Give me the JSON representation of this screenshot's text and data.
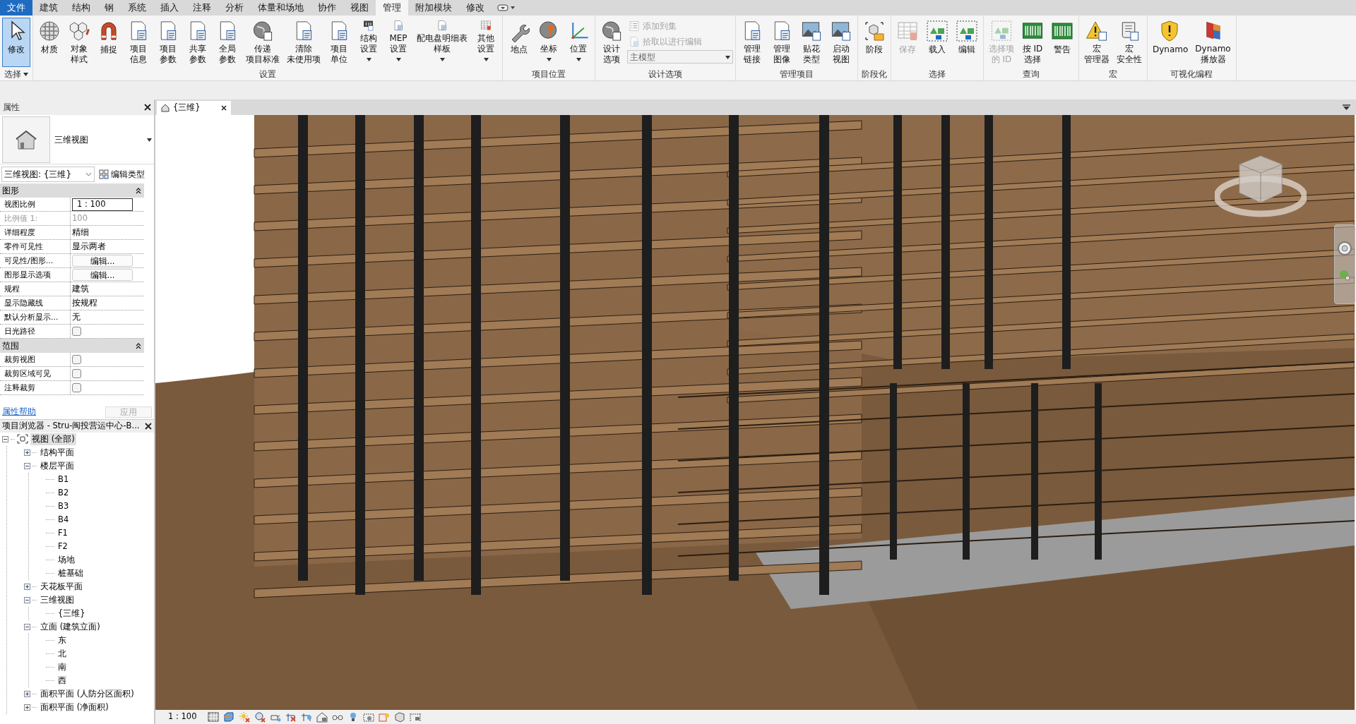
{
  "menu_tabs": [
    {
      "label": "文件",
      "kind": "file",
      "selected": false
    },
    {
      "label": "建筑",
      "kind": "tab",
      "selected": false
    },
    {
      "label": "结构",
      "kind": "tab",
      "selected": false
    },
    {
      "label": "钢",
      "kind": "tab",
      "selected": false
    },
    {
      "label": "系统",
      "kind": "tab",
      "selected": false
    },
    {
      "label": "插入",
      "kind": "tab",
      "selected": false
    },
    {
      "label": "注释",
      "kind": "tab",
      "selected": false
    },
    {
      "label": "分析",
      "kind": "tab",
      "selected": false
    },
    {
      "label": "体量和场地",
      "kind": "tab",
      "selected": false
    },
    {
      "label": "协作",
      "kind": "tab",
      "selected": false
    },
    {
      "label": "视图",
      "kind": "tab",
      "selected": false
    },
    {
      "label": "管理",
      "kind": "tab",
      "selected": true
    },
    {
      "label": "附加模块",
      "kind": "tab",
      "selected": false
    },
    {
      "label": "修改",
      "kind": "tab",
      "selected": false
    }
  ],
  "ribbon_groups": [
    {
      "label": "选择",
      "dropdown": true,
      "tools": [
        {
          "lines": [
            "修改"
          ],
          "kind": "large",
          "selected": true,
          "disabled": false
        }
      ]
    },
    {
      "label": "设置",
      "tools": [
        {
          "lines": [
            "材质"
          ],
          "kind": "large",
          "selected": false,
          "disabled": false
        },
        {
          "lines": [
            "对象",
            "样式"
          ],
          "kind": "large",
          "selected": false,
          "disabled": false
        },
        {
          "lines": [
            "捕捉"
          ],
          "kind": "large",
          "selected": false,
          "disabled": false
        },
        {
          "lines": [
            "项目",
            "信息"
          ],
          "kind": "large",
          "selected": false,
          "disabled": false
        },
        {
          "lines": [
            "项目",
            "参数"
          ],
          "kind": "large",
          "selected": false,
          "disabled": false
        },
        {
          "lines": [
            "共享",
            "参数"
          ],
          "kind": "large",
          "selected": false,
          "disabled": false
        },
        {
          "lines": [
            "全局",
            "参数"
          ],
          "kind": "large",
          "selected": false,
          "disabled": false
        },
        {
          "lines": [
            "传递",
            "项目标准"
          ],
          "kind": "large",
          "selected": false,
          "disabled": false
        },
        {
          "lines": [
            "清除",
            "未使用项"
          ],
          "kind": "large",
          "selected": false,
          "disabled": false
        },
        {
          "lines": [
            "项目",
            "单位"
          ],
          "kind": "large",
          "selected": false,
          "disabled": false
        },
        {
          "lines": [
            "结构",
            "设置"
          ],
          "kind": "large",
          "selected": false,
          "disabled": false,
          "dropdown": true
        },
        {
          "lines": [
            "MEP",
            "设置"
          ],
          "kind": "large",
          "selected": false,
          "disabled": false,
          "dropdown": true
        },
        {
          "lines": [
            "配电盘明细表",
            "样板"
          ],
          "kind": "large",
          "selected": false,
          "disabled": false,
          "dropdown": true
        },
        {
          "lines": [
            "其他",
            "设置"
          ],
          "kind": "large",
          "selected": false,
          "disabled": false,
          "dropdown": true
        }
      ]
    },
    {
      "label": "项目位置",
      "tools": [
        {
          "lines": [
            "地点"
          ],
          "kind": "large",
          "selected": false,
          "disabled": false
        },
        {
          "lines": [
            "坐标"
          ],
          "kind": "large",
          "selected": false,
          "disabled": false,
          "dropdown": true
        },
        {
          "lines": [
            "位置"
          ],
          "kind": "large",
          "selected": false,
          "disabled": false,
          "dropdown": true
        }
      ]
    },
    {
      "label": "设计选项",
      "tools": [
        {
          "lines": [
            "设计",
            "选项"
          ],
          "kind": "large",
          "selected": false,
          "disabled": false
        },
        {
          "lines": [
            "添加到集"
          ],
          "kind": "small",
          "selected": false,
          "disabled": true
        },
        {
          "lines": [
            "拾取以进行编辑"
          ],
          "kind": "small",
          "selected": false,
          "disabled": true
        },
        {
          "lines": [
            "主模型"
          ],
          "kind": "select",
          "selected": false,
          "disabled": true,
          "dropdown": true
        }
      ]
    },
    {
      "label": "管理项目",
      "tools": [
        {
          "lines": [
            "管理",
            "链接"
          ],
          "kind": "large",
          "selected": false,
          "disabled": false
        },
        {
          "lines": [
            "管理",
            "图像"
          ],
          "kind": "large",
          "selected": false,
          "disabled": false
        },
        {
          "lines": [
            "贴花",
            "类型"
          ],
          "kind": "large",
          "selected": false,
          "disabled": false
        },
        {
          "lines": [
            "启动",
            "视图"
          ],
          "kind": "large",
          "selected": false,
          "disabled": false
        }
      ]
    },
    {
      "label": "阶段化",
      "tools": [
        {
          "lines": [
            "阶段"
          ],
          "kind": "large",
          "selected": false,
          "disabled": false
        }
      ]
    },
    {
      "label": "选择",
      "tools": [
        {
          "lines": [
            "保存"
          ],
          "kind": "large",
          "selected": false,
          "disabled": true
        },
        {
          "lines": [
            "载入"
          ],
          "kind": "large",
          "selected": false,
          "disabled": false
        },
        {
          "lines": [
            "编辑"
          ],
          "kind": "large",
          "selected": false,
          "disabled": false
        }
      ]
    },
    {
      "label": "查询",
      "tools": [
        {
          "lines": [
            "选择项",
            "的 ID"
          ],
          "kind": "large",
          "selected": false,
          "disabled": true
        },
        {
          "lines": [
            "按 ID",
            "选择"
          ],
          "kind": "large",
          "selected": false,
          "disabled": false
        },
        {
          "lines": [
            "警告"
          ],
          "kind": "large",
          "selected": false,
          "disabled": false
        }
      ]
    },
    {
      "label": "宏",
      "tools": [
        {
          "lines": [
            "宏",
            "管理器"
          ],
          "kind": "large",
          "selected": false,
          "disabled": false
        },
        {
          "lines": [
            "宏",
            "安全性"
          ],
          "kind": "large",
          "selected": false,
          "disabled": false
        }
      ]
    },
    {
      "label": "可视化编程",
      "tools": [
        {
          "lines": [
            "Dynamo"
          ],
          "kind": "large",
          "selected": false,
          "disabled": false
        },
        {
          "lines": [
            "Dynamo",
            "播放器"
          ],
          "kind": "large",
          "selected": false,
          "disabled": false
        }
      ]
    }
  ],
  "properties": {
    "title": "属性",
    "type_name": "三维视图",
    "instance_selector": "三维视图: {三维}",
    "edit_type": "编辑类型",
    "sections": [
      {
        "label": "图形",
        "expanded": true,
        "rows": [
          {
            "label": "视图比例",
            "value": "1 : 100",
            "kind": "input",
            "disabled": false
          },
          {
            "label": "比例值 1:",
            "value": "100",
            "kind": "text",
            "disabled": true
          },
          {
            "label": "详细程度",
            "value": "精细",
            "kind": "text",
            "disabled": false
          },
          {
            "label": "零件可见性",
            "value": "显示两者",
            "kind": "text",
            "disabled": false
          },
          {
            "label": "可见性/图形...",
            "value": "编辑...",
            "kind": "button",
            "disabled": false
          },
          {
            "label": "图形显示选项",
            "value": "编辑...",
            "kind": "button",
            "disabled": false
          },
          {
            "label": "规程",
            "value": "建筑",
            "kind": "text",
            "disabled": false
          },
          {
            "label": "显示隐藏线",
            "value": "按规程",
            "kind": "text",
            "disabled": false
          },
          {
            "label": "默认分析显示...",
            "value": "无",
            "kind": "text",
            "disabled": false
          },
          {
            "label": "日光路径",
            "kind": "checkbox",
            "checked": false,
            "disabled": false
          }
        ]
      },
      {
        "label": "范围",
        "expanded": true,
        "rows": [
          {
            "label": "裁剪视图",
            "kind": "checkbox",
            "checked": false,
            "disabled": false
          },
          {
            "label": "裁剪区域可见",
            "kind": "checkbox",
            "checked": false,
            "disabled": false
          },
          {
            "label": "注释裁剪",
            "kind": "checkbox",
            "checked": false,
            "disabled": false
          }
        ]
      }
    ],
    "help_link": "属性帮助",
    "apply_button": "应用",
    "apply_disabled": true
  },
  "project_browser": {
    "title": "项目浏览器 - Stru-闽投营运中心-B...",
    "tree": [
      {
        "label": "视图 (全部)",
        "expanded": true,
        "selected": true,
        "children": [
          {
            "label": "结构平面",
            "expanded": false,
            "selected": false
          },
          {
            "label": "楼层平面",
            "expanded": true,
            "selected": false,
            "children": [
              {
                "label": "B1",
                "selected": false
              },
              {
                "label": "B2",
                "selected": false
              },
              {
                "label": "B3",
                "selected": false
              },
              {
                "label": "B4",
                "selected": false
              },
              {
                "label": "F1",
                "selected": false
              },
              {
                "label": "F2",
                "selected": false
              },
              {
                "label": "场地",
                "selected": false
              },
              {
                "label": "桩基础",
                "selected": false
              }
            ]
          },
          {
            "label": "天花板平面",
            "expanded": false,
            "selected": false
          },
          {
            "label": "三维视图",
            "expanded": true,
            "selected": false,
            "children": [
              {
                "label": "{三维}",
                "selected": false
              }
            ]
          },
          {
            "label": "立面 (建筑立面)",
            "expanded": true,
            "selected": false,
            "children": [
              {
                "label": "东",
                "selected": false
              },
              {
                "label": "北",
                "selected": false
              },
              {
                "label": "南",
                "selected": false
              },
              {
                "label": "西",
                "selected": false
              }
            ]
          },
          {
            "label": "面积平面 (人防分区面积)",
            "expanded": false,
            "selected": false
          },
          {
            "label": "面积平面 (净面积)",
            "expanded": false,
            "selected": false
          }
        ]
      }
    ]
  },
  "view_tabs": [
    {
      "label": "{三维}",
      "selected": true
    }
  ],
  "status_bar": {
    "scale": "1 : 100"
  }
}
